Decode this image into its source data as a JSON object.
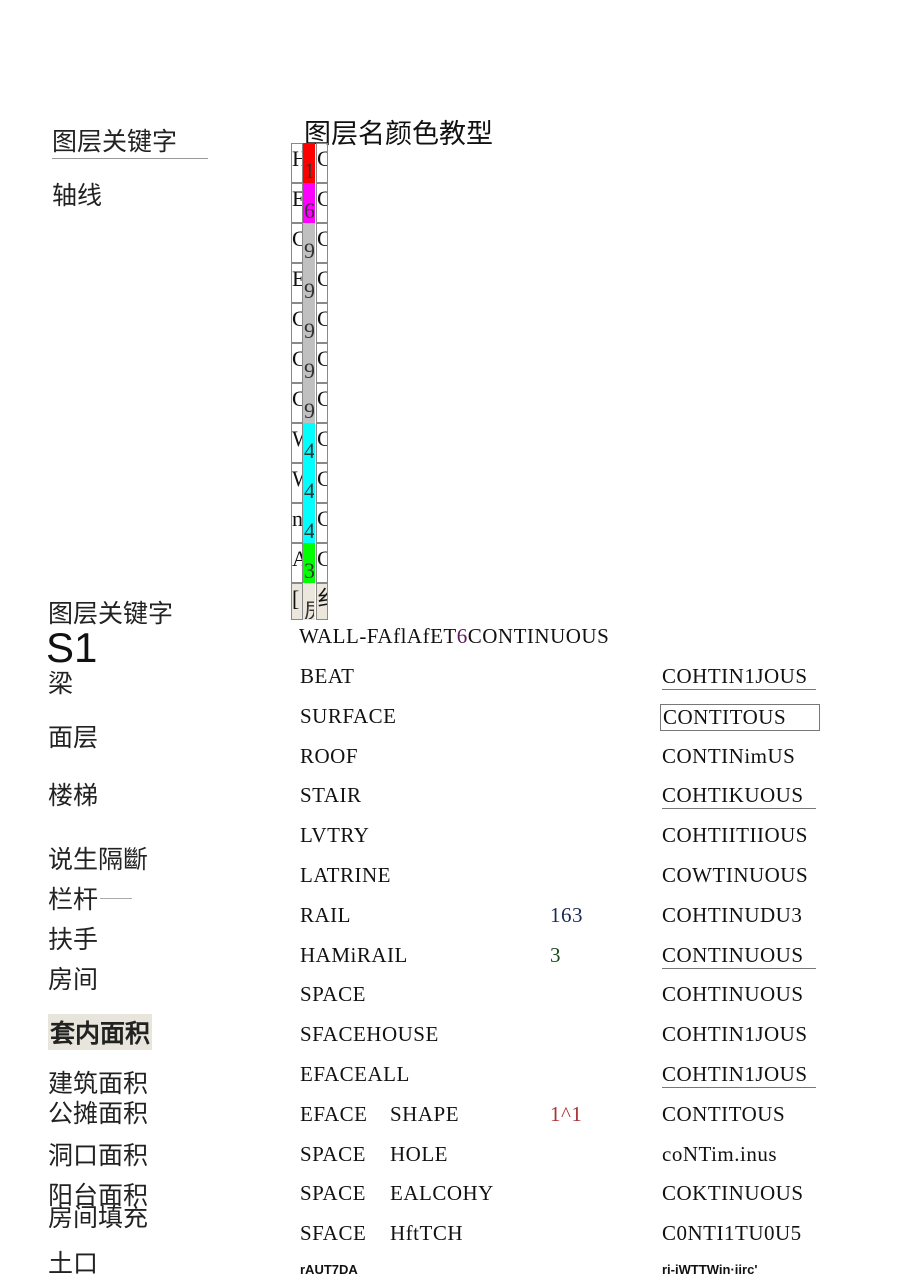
{
  "top": {
    "left_header": "图层关键字",
    "left_item": "轴线",
    "table_header": "图层名颜色教型",
    "rows": [
      {
        "name": "H",
        "color_num": "1",
        "ltype": "C",
        "color": "#ff0000"
      },
      {
        "name": "E",
        "color_num": "6",
        "ltype": "C",
        "color": "#ff00ff"
      },
      {
        "name": "C",
        "color_num": "9",
        "ltype": "C",
        "color": "#c0c0c0"
      },
      {
        "name": "E",
        "color_num": "9",
        "ltype": "C",
        "color": "#c0c0c0"
      },
      {
        "name": "C",
        "color_num": "9",
        "ltype": "C",
        "color": "#c0c0c0"
      },
      {
        "name": "C",
        "color_num": "9",
        "ltype": "C",
        "color": "#c0c0c0"
      },
      {
        "name": "C",
        "color_num": "9",
        "ltype": "C",
        "color": "#c0c0c0"
      },
      {
        "name": "W",
        "color_num": "4",
        "ltype": "C",
        "color": "#00ffff"
      },
      {
        "name": "W",
        "color_num": "4",
        "ltype": "C",
        "color": "#00ffff"
      },
      {
        "name": "n",
        "color_num": "4",
        "ltype": "C",
        "color": "#00ffff"
      },
      {
        "name": "A",
        "color_num": "3",
        "ltype": "C",
        "color": "#00ff00"
      },
      {
        "name": "[",
        "color_num": "房",
        "ltype": "纟",
        "color": "#ece7dc"
      }
    ]
  },
  "bottom": {
    "left_header": "图层关键字",
    "s1": "S1",
    "wall_line": "WALL-FAflAfET",
    "wall_num": "6",
    "wall_type": "CONTINUOUS",
    "rows": [
      {
        "key": "梁",
        "name": "BEAT",
        "name2": "",
        "num": "",
        "ltype": "COHTIN1JOUS",
        "ul": true
      },
      {
        "key": "面层",
        "name": "SURFACE",
        "name2": "",
        "num": "",
        "ltype": "CONTITOUS",
        "box": true
      },
      {
        "key": "楼梯",
        "name": "ROOF",
        "name2": "",
        "num": "",
        "ltype": "CONTINimUS"
      },
      {
        "key": "",
        "name": "STAIR",
        "name2": "",
        "num": "",
        "ltype": "COHTIKUOUS",
        "ul": true
      },
      {
        "key": "说生隔斷",
        "name": "LVTRY",
        "name2": "",
        "num": "",
        "ltype": "COHTIITIIOUS"
      },
      {
        "key": "栏杆",
        "name": "LATRINE",
        "name2": "",
        "num": "",
        "ltype": "COWTINUOUS"
      },
      {
        "key": "扶手",
        "name": "RAIL",
        "name2": "",
        "num": "163",
        "ltype": "COHTINUDU3"
      },
      {
        "key": "房间",
        "name": "HAMiRAIL",
        "name2": "",
        "num": "3",
        "ltype": "CONTINUOUS",
        "ul": true
      },
      {
        "key": "套内面积",
        "name": "SPACE",
        "name2": "",
        "num": "",
        "ltype": "COHTINUOUS"
      },
      {
        "key": "建筑面积",
        "name": "SFACEHOUSE",
        "name2": "",
        "num": "",
        "ltype": "COHTIN1JOUS"
      },
      {
        "key": "公摊面积",
        "name": "EFACEALL",
        "name2": "",
        "num": "",
        "ltype": "COHTIN1JOUS",
        "ul": true
      },
      {
        "key": "洞口面积",
        "name": "EFACE",
        "name2": "SHAPE",
        "num": "1^1",
        "ltype": "CONTITOUS"
      },
      {
        "key": "阳台面积",
        "name": "SPACE",
        "name2": "HOLE",
        "num": "",
        "ltype": "coNTim.inus"
      },
      {
        "key": "房间填充",
        "name": "SPACE",
        "name2": "EALCOHY",
        "num": "",
        "ltype": "COKTINUOUS"
      },
      {
        "key": "土口",
        "name": "SFACE",
        "name2": "HftTCH",
        "num": "",
        "ltype": "C0NTI1TU0U5"
      }
    ],
    "footer_left": "rAUT7DA",
    "footer_right": "ri-iWTTWin·iirc'"
  }
}
